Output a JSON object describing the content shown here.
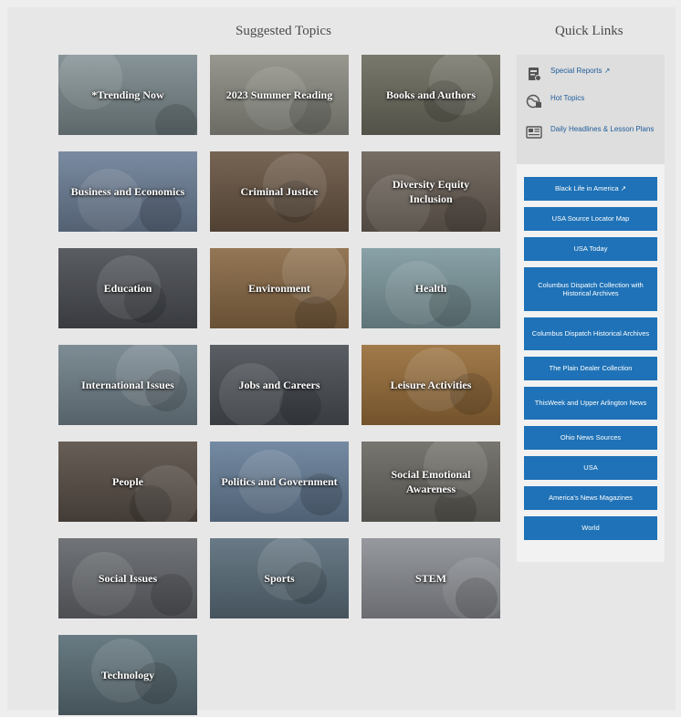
{
  "topics_heading": "Suggested Topics",
  "quick_links_heading": "Quick Links",
  "topics": [
    {
      "label": "*Trending Now",
      "color": "#7d8b8f"
    },
    {
      "label": "2023 Summer Reading",
      "color": "#8f8f86"
    },
    {
      "label": "Books and Authors",
      "color": "#6e6d60"
    },
    {
      "label": "Business and Economics",
      "color": "#6f8199"
    },
    {
      "label": "Criminal Justice",
      "color": "#6b5745"
    },
    {
      "label": "Diversity Equity Inclusion",
      "color": "#6b6157"
    },
    {
      "label": "Education",
      "color": "#4c4f55"
    },
    {
      "label": "Environment",
      "color": "#8b6b47"
    },
    {
      "label": "Health",
      "color": "#7f9aa0"
    },
    {
      "label": "International Issues",
      "color": "#73838c"
    },
    {
      "label": "Jobs and Careers",
      "color": "#4c5157"
    },
    {
      "label": "Leisure Activities",
      "color": "#9a6f3b"
    },
    {
      "label": "People",
      "color": "#5a5048"
    },
    {
      "label": "Politics and Government",
      "color": "#69819b"
    },
    {
      "label": "Social Emotional Awareness",
      "color": "#6c6a63"
    },
    {
      "label": "Social Issues",
      "color": "#65686d"
    },
    {
      "label": "Sports",
      "color": "#5c6f7c"
    },
    {
      "label": "STEM",
      "color": "#8d9096"
    },
    {
      "label": "Technology",
      "color": "#5c7078"
    }
  ],
  "quick_links": [
    {
      "label": "Special Reports ↗",
      "icon": "report-icon"
    },
    {
      "label": "Hot Topics",
      "icon": "globe-icon"
    },
    {
      "label": "Daily Headlines & Lesson Plans",
      "icon": "newspaper-icon"
    }
  ],
  "buttons": [
    {
      "label": "Black Life in America ↗",
      "lines": 1
    },
    {
      "label": "USA Source Locator Map",
      "lines": 1
    },
    {
      "label": "USA Today",
      "lines": 1
    },
    {
      "label": "Columbus Dispatch Collection with Historical Archives",
      "lines": 3
    },
    {
      "label": "Columbus Dispatch Historical Archives",
      "lines": 2
    },
    {
      "label": "The Plain Dealer Collection",
      "lines": 1
    },
    {
      "label": "ThisWeek and Upper Arlington News",
      "lines": 2
    },
    {
      "label": "Ohio News Sources",
      "lines": 1
    },
    {
      "label": "USA",
      "lines": 1
    },
    {
      "label": "America's News Magazines",
      "lines": 1
    },
    {
      "label": "World",
      "lines": 1
    }
  ],
  "colors": {
    "button": "#1f72b7",
    "link": "#1f5d99",
    "background": "#e7e7e7"
  }
}
